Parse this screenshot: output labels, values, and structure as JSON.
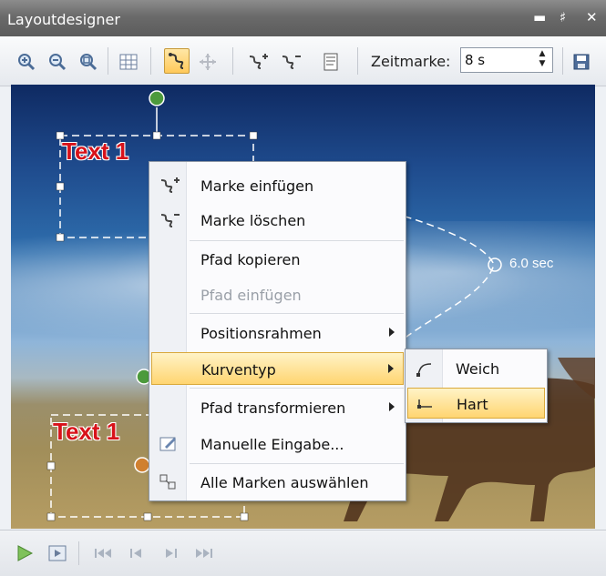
{
  "window": {
    "title": "Layoutdesigner"
  },
  "toolbar": {
    "zeitmarke_label": "Zeitmarke:",
    "zeitmarke_value": "8 s"
  },
  "canvas": {
    "text_top": "Text 1",
    "text_bottom": "Text 1",
    "time_mark": "6.0 sec"
  },
  "context_menu": {
    "items": [
      {
        "label": "Marke einfügen",
        "underline": "M"
      },
      {
        "label": "Marke löschen",
        "underline": "l"
      },
      {
        "label": "Pfad kopieren",
        "underline": "k"
      },
      {
        "label": "Pfad einfügen",
        "underline": "e",
        "disabled": true
      },
      {
        "label": "Positionsrahmen",
        "underline": "P"
      },
      {
        "label": "Kurventyp",
        "underline": "K"
      },
      {
        "label": "Pfad transformieren",
        "underline": "t"
      },
      {
        "label": "Manuelle Eingabe...",
        "underline": "a"
      },
      {
        "label": "Alle Marken auswählen",
        "underline": "w"
      }
    ]
  },
  "submenu": {
    "items": [
      {
        "label": "Weich"
      },
      {
        "label": "Hart"
      }
    ]
  },
  "colors": {
    "highlight": "#ffd571",
    "text_red": "#d8121a"
  }
}
